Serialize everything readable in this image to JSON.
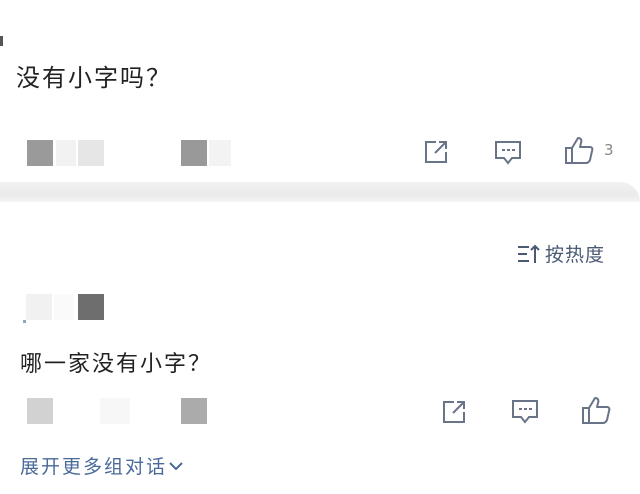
{
  "post": {
    "text": "没有小字吗？",
    "like_count": "3"
  },
  "sort": {
    "label": "按热度"
  },
  "comment": {
    "text": "哪一家没有小字？"
  },
  "expand": {
    "label": "展开更多组对话"
  },
  "colors": {
    "icon": "#6a7489",
    "link": "#4a6a9a",
    "divider": "#ededed"
  },
  "icons": [
    "share-icon",
    "comment-icon",
    "like-icon",
    "sort-icon",
    "chevron-down-icon"
  ]
}
